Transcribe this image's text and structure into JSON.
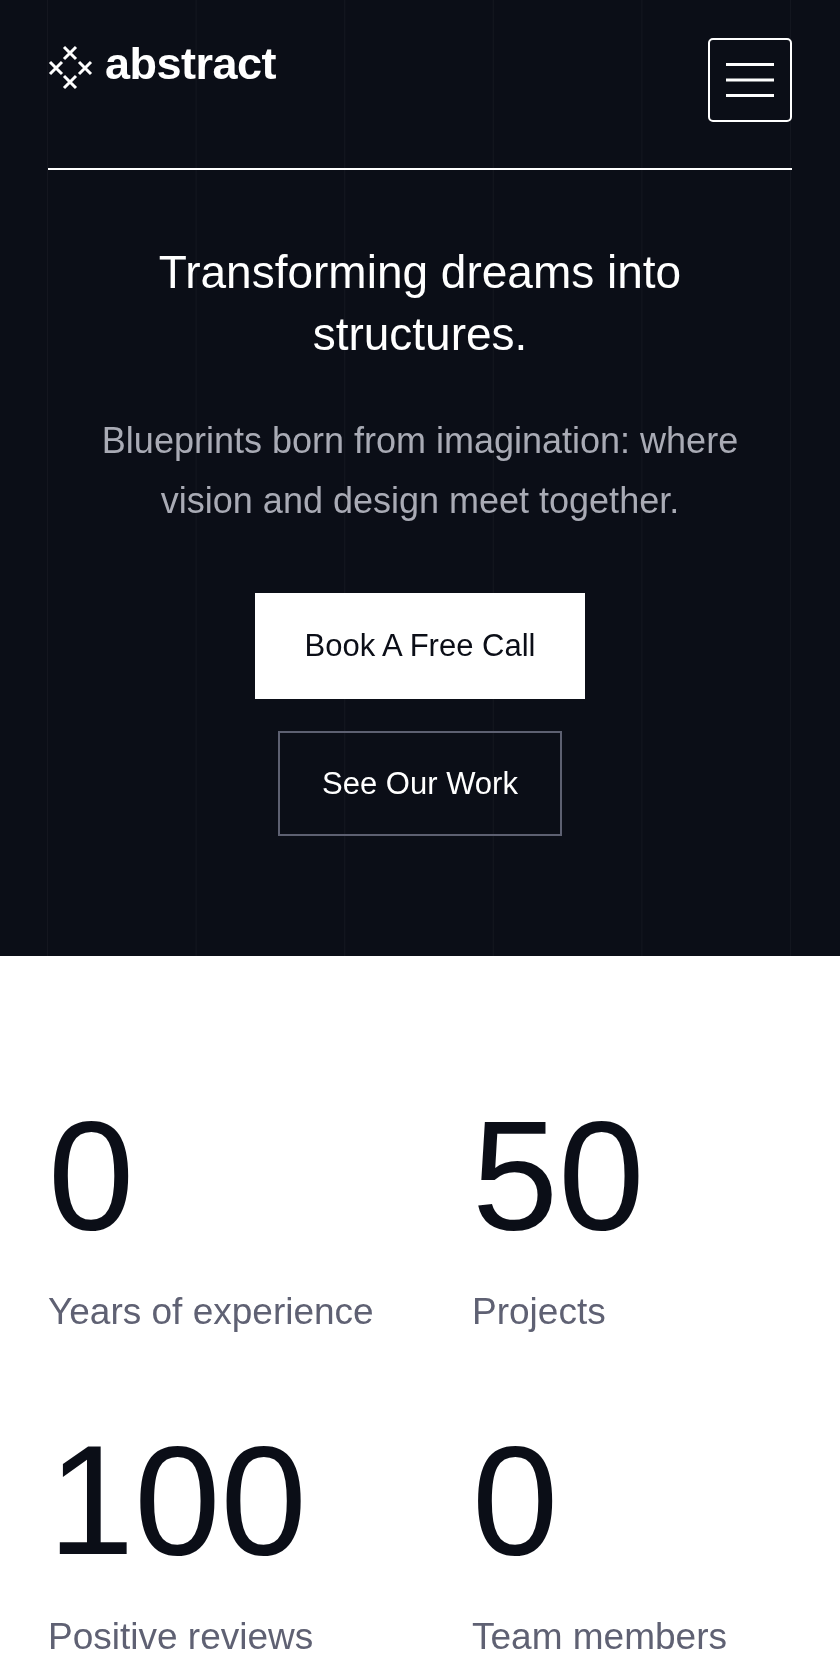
{
  "header": {
    "logo_text": "abstract"
  },
  "hero": {
    "title": "Transforming dreams into structures.",
    "subtitle": "Blueprints born from imagination: where vision and design meet together.",
    "buttons": [
      {
        "label": "Book A Free Call",
        "kind": "primary"
      },
      {
        "label": "See Our Work",
        "kind": "outline"
      }
    ]
  },
  "stats": [
    {
      "value": "0",
      "label": "Years of experience"
    },
    {
      "value": "50",
      "label": "Projects"
    },
    {
      "value": "100",
      "label": "Positive reviews"
    },
    {
      "value": "0",
      "label": "Team members"
    }
  ]
}
